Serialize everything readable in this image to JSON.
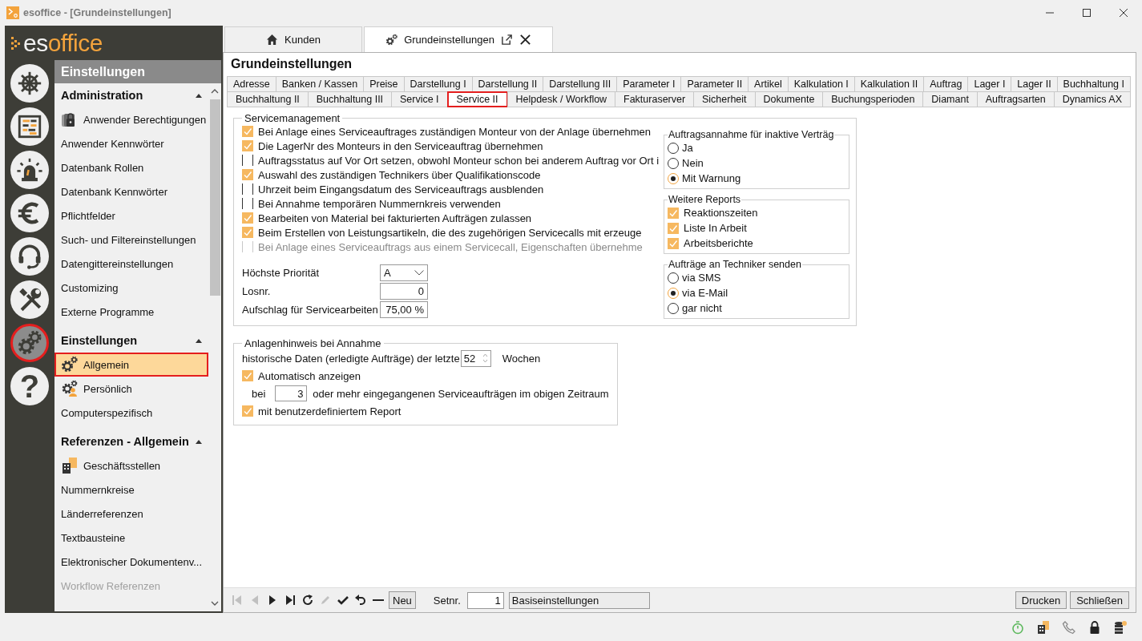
{
  "window": {
    "title": "esoffice - [Grundeinstellungen]"
  },
  "logo": [
    "es",
    "office"
  ],
  "rail": [
    {
      "selected": false
    },
    {
      "selected": false
    },
    {
      "selected": false
    },
    {
      "selected": false
    },
    {
      "selected": false
    },
    {
      "selected": false
    },
    {
      "selected": true
    },
    {
      "selected": false,
      "label": "?"
    }
  ],
  "sidebar": {
    "title": "Einstellungen",
    "sections": [
      {
        "title": "Administration",
        "expanded": true,
        "items": [
          {
            "label": "Anwender Berechtigungen",
            "kind": "lock",
            "selected": false,
            "disabled": false
          },
          {
            "label": "Anwender Kennwörter",
            "kind": "plain",
            "selected": false,
            "disabled": false
          },
          {
            "label": "Datenbank Rollen",
            "kind": "plain",
            "selected": false,
            "disabled": false
          },
          {
            "label": "Datenbank Kennwörter",
            "kind": "plain",
            "selected": false,
            "disabled": false
          },
          {
            "label": "Pflichtfelder",
            "kind": "plain",
            "selected": false,
            "disabled": false
          },
          {
            "label": "Such- und Filtereinstellungen",
            "kind": "plain",
            "selected": false,
            "disabled": false
          },
          {
            "label": "Datengittereinstellungen",
            "kind": "plain",
            "selected": false,
            "disabled": false
          },
          {
            "label": "Customizing",
            "kind": "plain",
            "selected": false,
            "disabled": false
          },
          {
            "label": "Externe Programme",
            "kind": "plain",
            "selected": false,
            "disabled": false
          }
        ]
      },
      {
        "title": "Einstellungen",
        "expanded": true,
        "items": [
          {
            "label": "Allgemein",
            "kind": "gears",
            "selected": true,
            "disabled": false
          },
          {
            "label": "Persönlich",
            "kind": "gears-person",
            "selected": false,
            "disabled": false
          },
          {
            "label": "Computerspezifisch",
            "kind": "plain",
            "selected": false,
            "disabled": false
          }
        ]
      },
      {
        "title": "Referenzen - Allgemein",
        "expanded": true,
        "items": [
          {
            "label": "Geschäftsstellen",
            "kind": "building",
            "selected": false,
            "disabled": false
          },
          {
            "label": "Nummernkreise",
            "kind": "plain",
            "selected": false,
            "disabled": false
          },
          {
            "label": "Länderreferenzen",
            "kind": "plain",
            "selected": false,
            "disabled": false
          },
          {
            "label": "Textbausteine",
            "kind": "plain",
            "selected": false,
            "disabled": false
          },
          {
            "label": "Elektronischer Dokumentenv...",
            "kind": "plain",
            "selected": false,
            "disabled": false
          },
          {
            "label": "Workflow Referenzen",
            "kind": "plain",
            "selected": false,
            "disabled": true
          }
        ]
      }
    ]
  },
  "doc_tabs": [
    {
      "label": "Kunden",
      "selected": false
    },
    {
      "label": "Grundeinstellungen",
      "selected": true
    }
  ],
  "page_title": "Grundeinstellungen",
  "settings_tabs": [
    [
      {
        "label": "Adresse",
        "selected": false
      },
      {
        "label": "Banken / Kassen",
        "selected": false
      },
      {
        "label": "Preise",
        "selected": false
      },
      {
        "label": "Darstellung I",
        "selected": false
      },
      {
        "label": "Darstellung II",
        "selected": false
      },
      {
        "label": "Darstellung III",
        "selected": false
      },
      {
        "label": "Parameter I",
        "selected": false
      },
      {
        "label": "Parameter II",
        "selected": false
      },
      {
        "label": "Artikel",
        "selected": false
      },
      {
        "label": "Kalkulation I",
        "selected": false
      },
      {
        "label": "Kalkulation II",
        "selected": false
      },
      {
        "label": "Auftrag",
        "selected": false
      },
      {
        "label": "Lager I",
        "selected": false
      },
      {
        "label": "Lager II",
        "selected": false
      },
      {
        "label": "Buchhaltung I",
        "selected": false
      }
    ],
    [
      {
        "label": "Buchhaltung II",
        "selected": false
      },
      {
        "label": "Buchhaltung III",
        "selected": false
      },
      {
        "label": "Service I",
        "selected": false
      },
      {
        "label": "Service II",
        "selected": true
      },
      {
        "label": "Helpdesk / Workflow",
        "selected": false
      },
      {
        "label": "Fakturaserver",
        "selected": false
      },
      {
        "label": "Sicherheit",
        "selected": false
      },
      {
        "label": "Dokumente",
        "selected": false
      },
      {
        "label": "Buchungsperioden",
        "selected": false
      },
      {
        "label": "Diamant",
        "selected": false
      },
      {
        "label": "Auftragsarten",
        "selected": false
      },
      {
        "label": "Dynamics AX",
        "selected": false
      }
    ]
  ],
  "servicemanagement": {
    "title": "Servicemanagement",
    "options": [
      {
        "label": "Bei Anlage eines Serviceauftrages zuständigen Monteur von der Anlage übernehmen",
        "checked": true,
        "disabled": false
      },
      {
        "label": "Die LagerNr des Monteurs in den Serviceauftrag übernehmen",
        "checked": true,
        "disabled": false
      },
      {
        "label": "Auftragsstatus auf Vor Ort setzen, obwohl Monteur schon bei anderem Auftrag vor Ort i",
        "checked": false,
        "disabled": false
      },
      {
        "label": "Auswahl des zuständigen Technikers über Qualifikationscode",
        "checked": true,
        "disabled": false
      },
      {
        "label": "Uhrzeit beim Eingangsdatum des Serviceauftrags ausblenden",
        "checked": false,
        "disabled": false
      },
      {
        "label": "Bei Annahme temporären Nummernkreis verwenden",
        "checked": false,
        "disabled": false
      },
      {
        "label": "Bearbeiten von Material bei fakturierten Aufträgen zulassen",
        "checked": true,
        "disabled": false
      },
      {
        "label": "Beim Erstellen von Leistungsartikeln, die des zugehörigen Servicecalls mit erzeuge",
        "checked": true,
        "disabled": false
      },
      {
        "label": "Bei Anlage eines Serviceauftrags aus einem Servicecall, Eigenschaften übernehme",
        "checked": false,
        "disabled": true
      }
    ],
    "fields": [
      {
        "label": "Höchste Priorität",
        "value": "A",
        "kind": "dropdown"
      },
      {
        "label": "Losnr.",
        "value": "0",
        "kind": "number"
      },
      {
        "label": "Aufschlag für Servicearbeiten",
        "value": "75,00 %",
        "kind": "number"
      }
    ]
  },
  "inactive_contracts": {
    "title": "Auftragsannahme für inaktive Verträg",
    "options": [
      {
        "label": "Ja",
        "selected": false
      },
      {
        "label": "Nein",
        "selected": false
      },
      {
        "label": "Mit Warnung",
        "selected": true
      }
    ]
  },
  "reports": {
    "title": "Weitere Reports",
    "options": [
      {
        "label": "Reaktionszeiten",
        "checked": true
      },
      {
        "label": "Liste In Arbeit",
        "checked": true
      },
      {
        "label": "Arbeitsberichte",
        "checked": true
      }
    ]
  },
  "send_orders": {
    "title": "Aufträge an Techniker senden",
    "options": [
      {
        "label": "via SMS",
        "selected": false
      },
      {
        "label": "via E-Mail",
        "selected": true
      },
      {
        "label": "gar nicht",
        "selected": false
      }
    ]
  },
  "asset_notice": {
    "title": "Anlagenhinweis bei Annahme",
    "history_label": "historische Daten (erledigte Aufträge) der letzte",
    "history_value": "52",
    "history_unit": "Wochen",
    "auto_show": {
      "label": "Automatisch anzeigen",
      "checked": true
    },
    "threshold_prefix": "bei",
    "threshold_value": "3",
    "threshold_suffix": "oder mehr eingegangenen Serviceaufträgen im obigen Zeitraum",
    "custom_report": {
      "label": "mit benutzerdefiniertem Report",
      "checked": true
    }
  },
  "toolbar": {
    "icons": [
      {
        "disabled": true
      },
      {
        "disabled": true
      },
      {
        "disabled": false
      },
      {
        "disabled": false
      },
      {
        "disabled": false
      },
      {
        "disabled": true
      },
      {
        "disabled": false
      },
      {
        "disabled": false
      },
      {
        "disabled": false
      }
    ],
    "new_button": "Neu",
    "set_label": "Setnr.",
    "set_number": "1",
    "set_name": "Basiseinstellungen",
    "buttons": [
      "Drucken",
      "Schließen"
    ]
  }
}
